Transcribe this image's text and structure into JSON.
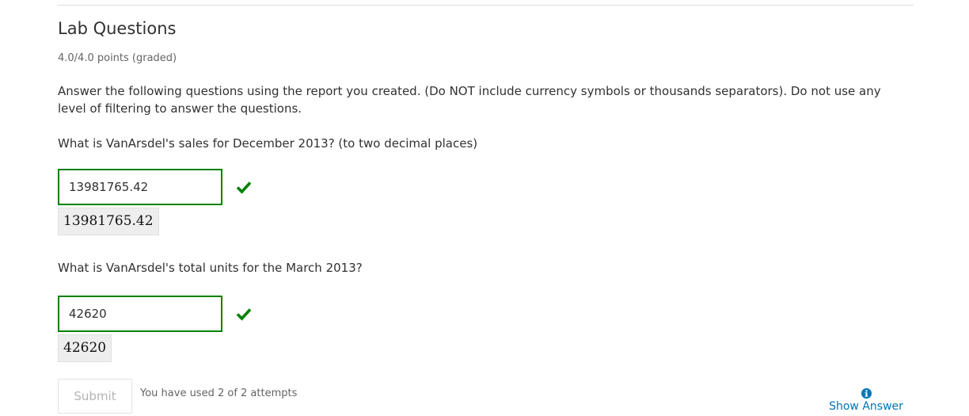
{
  "problem": {
    "title": "Lab Questions",
    "points": "4.0/4.0 points (graded)",
    "intro": "Answer the following questions using the report you created. (Do NOT include currency symbols or thousands separators). Do not use any level of filtering to answer the questions."
  },
  "questions": [
    {
      "prompt": "What is VanArsdel's sales for December 2013? (to two decimal places)",
      "answer_value": "13981765.42",
      "preview": "13981765.42",
      "status": "correct",
      "status_icon": "checkmark-icon"
    },
    {
      "prompt": "What is VanArsdel's total units for the March 2013?",
      "answer_value": "42620",
      "preview": "42620",
      "status": "correct",
      "status_icon": "checkmark-icon"
    }
  ],
  "actions": {
    "submit_label": "Submit",
    "submit_disabled": true,
    "attempts_text": "You have used 2 of 2 attempts",
    "show_answer_label": "Show Answer",
    "show_answer_icon": "info-circle-icon"
  },
  "colors": {
    "correct": "#008100",
    "link": "#0075b4",
    "text": "#313131",
    "muted": "#646464"
  }
}
